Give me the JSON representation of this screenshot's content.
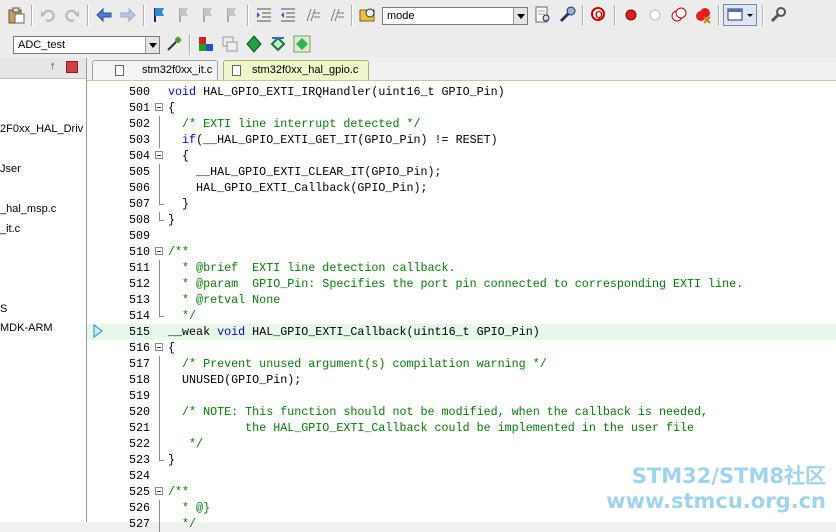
{
  "toolbar": {
    "find_combo": "mode",
    "target_combo": "ADC_test"
  },
  "left_panel": {
    "pin_glyph": "↑",
    "items": [
      "2F0xx_HAL_Driv",
      "Jser",
      "_hal_msp.c",
      "_it.c",
      "S",
      "MDK-ARM"
    ]
  },
  "tabs": [
    {
      "label": "stm32f0xx_it.c",
      "active": false
    },
    {
      "label": "stm32f0xx_hal_gpio.c",
      "active": true
    }
  ],
  "editor": {
    "current_line": 515,
    "lines": [
      {
        "n": "500",
        "fold": "none",
        "segs": [
          {
            "t": "void",
            "c": "kw"
          },
          {
            "t": " HAL_GPIO_EXTI_IRQHandler(uint16_t GPIO_Pin)",
            "c": ""
          }
        ]
      },
      {
        "n": "501",
        "fold": "box",
        "segs": [
          {
            "t": "{",
            "c": ""
          }
        ]
      },
      {
        "n": "502",
        "fold": "line",
        "segs": [
          {
            "t": "  ",
            "c": ""
          },
          {
            "t": "/* EXTI line interrupt detected */",
            "c": "cm"
          }
        ]
      },
      {
        "n": "503",
        "fold": "line",
        "segs": [
          {
            "t": "  ",
            "c": ""
          },
          {
            "t": "if",
            "c": "kw"
          },
          {
            "t": "(__HAL_GPIO_EXTI_GET_IT(GPIO_Pin) != RESET)",
            "c": ""
          }
        ]
      },
      {
        "n": "504",
        "fold": "box",
        "segs": [
          {
            "t": "  {",
            "c": ""
          }
        ]
      },
      {
        "n": "505",
        "fold": "line",
        "segs": [
          {
            "t": "    __HAL_GPIO_EXTI_CLEAR_IT(GPIO_Pin);",
            "c": ""
          }
        ]
      },
      {
        "n": "506",
        "fold": "line",
        "segs": [
          {
            "t": "    HAL_GPIO_EXTI_Callback(GPIO_Pin);",
            "c": ""
          }
        ]
      },
      {
        "n": "507",
        "fold": "end",
        "segs": [
          {
            "t": "  }",
            "c": ""
          }
        ]
      },
      {
        "n": "508",
        "fold": "end",
        "segs": [
          {
            "t": "}",
            "c": ""
          }
        ]
      },
      {
        "n": "509",
        "fold": "none",
        "segs": []
      },
      {
        "n": "510",
        "fold": "box",
        "segs": [
          {
            "t": "/**",
            "c": "cm"
          }
        ]
      },
      {
        "n": "511",
        "fold": "line",
        "segs": [
          {
            "t": "  * @brief  EXTI line detection callback.",
            "c": "cm"
          }
        ]
      },
      {
        "n": "512",
        "fold": "line",
        "segs": [
          {
            "t": "  * @param  GPIO_Pin: Specifies the port pin connected to corresponding EXTI line.",
            "c": "cm"
          }
        ]
      },
      {
        "n": "513",
        "fold": "line",
        "segs": [
          {
            "t": "  * @retval None",
            "c": "cm"
          }
        ]
      },
      {
        "n": "514",
        "fold": "end",
        "segs": [
          {
            "t": "  */",
            "c": "cm"
          }
        ]
      },
      {
        "n": "515",
        "fold": "none",
        "segs": [
          {
            "t": "__weak ",
            "c": ""
          },
          {
            "t": "void",
            "c": "kw"
          },
          {
            "t": " HAL_GPIO_EXTI_Callback(uint16_t GPIO_Pin)",
            "c": ""
          }
        ]
      },
      {
        "n": "516",
        "fold": "box",
        "segs": [
          {
            "t": "{",
            "c": ""
          }
        ]
      },
      {
        "n": "517",
        "fold": "line",
        "segs": [
          {
            "t": "  ",
            "c": ""
          },
          {
            "t": "/* Prevent unused argument(s) compilation warning */",
            "c": "cm"
          }
        ]
      },
      {
        "n": "518",
        "fold": "line",
        "segs": [
          {
            "t": "  UNUSED(GPIO_Pin);",
            "c": ""
          }
        ]
      },
      {
        "n": "519",
        "fold": "line",
        "segs": []
      },
      {
        "n": "520",
        "fold": "line",
        "segs": [
          {
            "t": "  ",
            "c": ""
          },
          {
            "t": "/* NOTE: This function should not be modified, when the callback is needed,",
            "c": "cm"
          }
        ]
      },
      {
        "n": "521",
        "fold": "line",
        "segs": [
          {
            "t": "           the HAL_GPIO_EXTI_Callback could be implemented in the user file",
            "c": "cm"
          }
        ]
      },
      {
        "n": "522",
        "fold": "line",
        "segs": [
          {
            "t": "   */",
            "c": "cm"
          }
        ]
      },
      {
        "n": "523",
        "fold": "end",
        "segs": [
          {
            "t": "}",
            "c": ""
          }
        ]
      },
      {
        "n": "524",
        "fold": "none",
        "segs": []
      },
      {
        "n": "525",
        "fold": "box",
        "segs": [
          {
            "t": "/**",
            "c": "cm"
          }
        ]
      },
      {
        "n": "526",
        "fold": "line",
        "segs": [
          {
            "t": "  * @}",
            "c": "cm"
          }
        ]
      },
      {
        "n": "527",
        "fold": "line",
        "segs": [
          {
            "t": "  */",
            "c": "cm"
          }
        ]
      }
    ]
  },
  "watermark": {
    "line1": "STM32/STM8社区",
    "line2": "www.stmcu.org.cn"
  },
  "colors": {
    "keyword": "#0000ff",
    "comment": "#008000",
    "current_line_bg": "#e8f8e8"
  }
}
